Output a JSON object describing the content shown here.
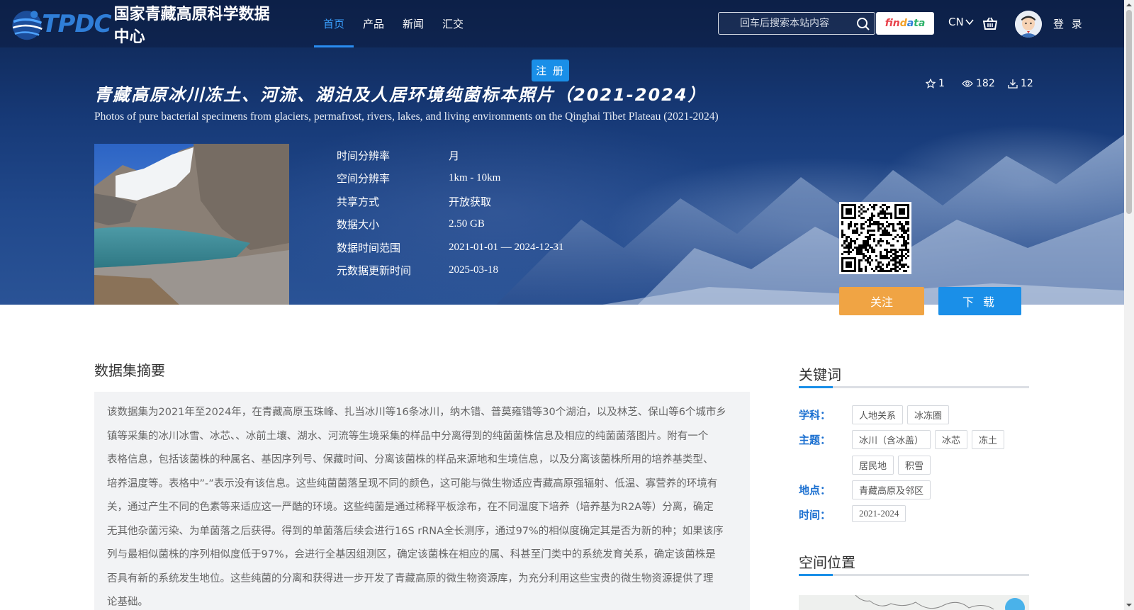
{
  "logo": {
    "brand": "TPDC",
    "name": "国家青藏高原科学数据中心"
  },
  "nav": [
    {
      "label": "首页",
      "active": true
    },
    {
      "label": "产品"
    },
    {
      "label": "新闻"
    },
    {
      "label": "汇交"
    }
  ],
  "search": {
    "placeholder": "回车后搜索本站内容"
  },
  "findata": {
    "p1": "fin",
    "p2": "d",
    "p3": "a",
    "p4": "ta"
  },
  "lang": "CN",
  "login": "登 录",
  "register": "注 册",
  "dataset": {
    "title_cn": "青藏高原冰川冻土、河流、湖泊及人居环境纯菌标本照片（2021-2024）",
    "title_en": "Photos of pure bacterial specimens from glaciers, permafrost, rivers, lakes, and living environments on the Qinghai Tibet Plateau (2021-2024)",
    "stars": "1",
    "views": "182",
    "downloads": "12",
    "meta": [
      {
        "label": "时间分辨率",
        "value": "月"
      },
      {
        "label": "空间分辨率",
        "value": "1km - 10km"
      },
      {
        "label": "共享方式",
        "value": "开放获取"
      },
      {
        "label": "数据大小",
        "value": "2.50 GB"
      },
      {
        "label": "数据时间范围",
        "value": "2021-01-01 — 2024-12-31"
      },
      {
        "label": "元数据更新时间",
        "value": "2025-03-18"
      }
    ],
    "follow": "关注",
    "download": "下 载"
  },
  "abstract": {
    "title": "数据集摘要",
    "lines": [
      "该数据集为2021年至2024年，在青藏高原玉珠峰、扎当冰川等16条冰川，纳木错、普莫雍错等30个湖泊，以及林芝、保山等6个城市乡",
      "镇等采集的冰川冰雪、冰芯、、冰前土壤、湖水、河流等生境采集的样品中分离得到的纯菌菌株信息及相应的纯菌菌落图片。附有一个",
      "表格信息，包括该菌株的种属名、基因序列号、保藏时间、分离该菌株的样品来源地和生境信息，以及分离该菌株所用的培养基类型、",
      "培养温度等。表格中”-”表示没有该信息。这些纯菌菌落呈现不同的颜色，这可能与微生物适应青藏高原强辐射、低温、寡营养的环境有",
      "关，通过产生不同的色素等来适应这一严酷的环境。这些纯菌是通过稀释平板涂布，在不同温度下培养（培养基为R2A等）分离，确定",
      "无其他杂菌污染、为单菌落之后获得。得到的单菌落后续会进行16S rRNA全长测序，通过97%的相似度确定其是否为新的种；如果该序",
      "列与最相似菌株的序列相似度低于97%，会进行全基因组测区，确定该菌株在相应的属、科甚至门类中的系统发育关系，确定该菌株是",
      "否具有新的系统发生地位。这些纯菌的分离和获得进一步开发了青藏高原的微生物资源库，为充分利用这些宝贵的微生物资源提供了理",
      "论基础。"
    ]
  },
  "keywords": {
    "title": "关键词",
    "groups": [
      {
        "label": "学科：",
        "tags": [
          "人地关系",
          "冰冻圈"
        ]
      },
      {
        "label": "主题：",
        "tags": [
          "冰川（含冰盖）",
          "冰芯",
          "冻土",
          "居民地",
          "积雪"
        ]
      },
      {
        "label": "地点：",
        "tags": [
          "青藏高原及邻区"
        ]
      },
      {
        "label": "时间：",
        "tags": [
          "2021-2024"
        ]
      }
    ]
  },
  "location": {
    "title": "空间位置"
  },
  "colors": {
    "accent": "#1a8fe8",
    "follow": "#f0a444",
    "keyword_label": "#1a6fd0"
  }
}
